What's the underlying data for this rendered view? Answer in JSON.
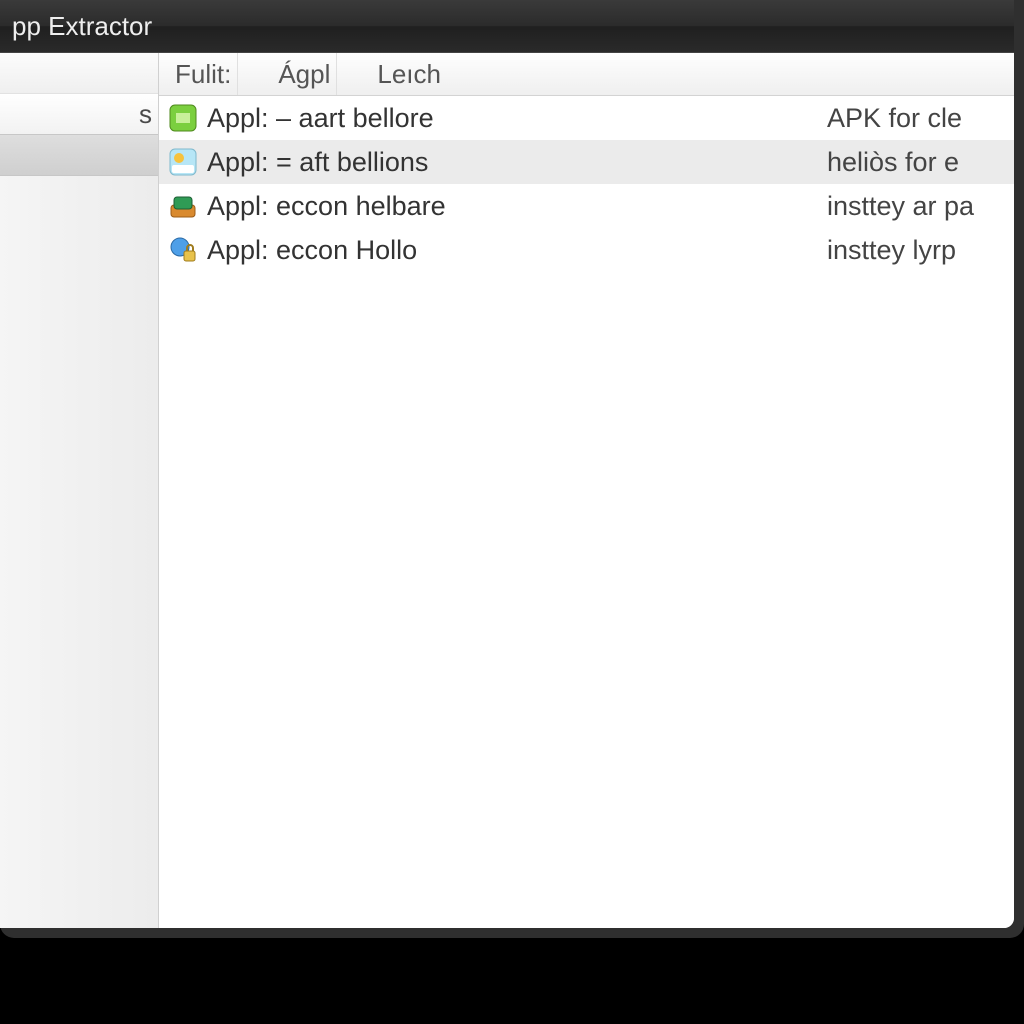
{
  "window": {
    "title": "pp Extractor"
  },
  "sidebar": {
    "items": [
      {
        "label": ""
      },
      {
        "label": "s"
      },
      {
        "label": ""
      }
    ],
    "selected_index": 2
  },
  "columns": {
    "c0": "Fulit:",
    "c1": "Ágpl",
    "c2": "Leıch"
  },
  "rows": [
    {
      "icon": "leaf-icon",
      "bg": "#7BCF3F",
      "fg": "#3E7A12",
      "name": "Appl: – aart bellore",
      "desc": "APK for cle",
      "selected": false
    },
    {
      "icon": "sun-icon",
      "bg": "#BEE8F8",
      "fg": "#F2B933",
      "name": "Appl: = aft bellions",
      "desc": "heliòs for e",
      "selected": true
    },
    {
      "icon": "box-icon",
      "bg": "#E39A3C",
      "fg": "#2F9B55",
      "name": "Appl: eccon helbare",
      "desc": "insttey ar pa",
      "selected": false
    },
    {
      "icon": "lock-icon",
      "bg": "#4E9FE8",
      "fg": "#E8C24B",
      "name": "Appl: eccon Hollo",
      "desc": "insttey lyrp",
      "selected": false
    }
  ]
}
